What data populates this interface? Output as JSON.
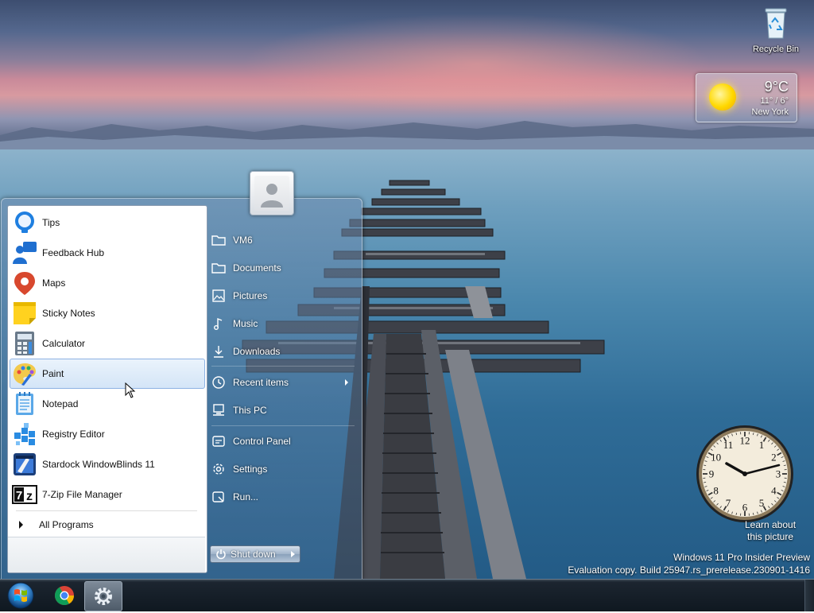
{
  "desktop": {
    "recycle_bin_label": "Recycle Bin",
    "learn_about": [
      "Learn about",
      "this picture"
    ],
    "watermark": [
      "Windows 11 Pro Insider Preview",
      "Evaluation copy. Build 25947.rs_prerelease.230901-1416"
    ]
  },
  "weather": {
    "temperature": "9°C",
    "range": "11° / 6°",
    "city": "New York",
    "icon": "sun-icon"
  },
  "clock": {
    "time": "10:10",
    "numbers": [
      "12",
      "1",
      "2",
      "3",
      "4",
      "5",
      "6",
      "7",
      "8",
      "9",
      "10",
      "11"
    ]
  },
  "start_menu": {
    "programs": [
      {
        "label": "Tips",
        "icon": "tips-icon"
      },
      {
        "label": "Feedback Hub",
        "icon": "feedback-hub-icon"
      },
      {
        "label": "Maps",
        "icon": "maps-icon"
      },
      {
        "label": "Sticky Notes",
        "icon": "sticky-notes-icon"
      },
      {
        "label": "Calculator",
        "icon": "calculator-icon"
      },
      {
        "label": "Paint",
        "icon": "paint-icon"
      },
      {
        "label": "Notepad",
        "icon": "notepad-icon"
      },
      {
        "label": "Registry Editor",
        "icon": "registry-editor-icon"
      },
      {
        "label": "Stardock WindowBlinds 11",
        "icon": "windowblinds-icon"
      },
      {
        "label": "7-Zip File Manager",
        "icon": "7zip-icon"
      }
    ],
    "selected_program": "Paint",
    "all_programs_label": "All Programs",
    "places": [
      {
        "label": "VM6",
        "icon": "user-folder-icon"
      },
      {
        "label": "Documents",
        "icon": "documents-icon"
      },
      {
        "label": "Pictures",
        "icon": "pictures-icon"
      },
      {
        "label": "Music",
        "icon": "music-icon"
      },
      {
        "label": "Downloads",
        "icon": "downloads-icon"
      },
      {
        "label": "Recent items",
        "icon": "recent-items-icon"
      },
      {
        "label": "This PC",
        "icon": "this-pc-icon"
      },
      {
        "label": "Control Panel",
        "icon": "control-panel-icon"
      },
      {
        "label": "Settings",
        "icon": "settings-icon"
      },
      {
        "label": "Run...",
        "icon": "run-icon"
      }
    ],
    "shutdown_label": "Shut down"
  },
  "taskbar": {
    "items": [
      "Start",
      "Google Chrome",
      "Settings"
    ]
  },
  "colors": {
    "selection_border": "#8db2e3",
    "taskbar": "#0f1820"
  }
}
